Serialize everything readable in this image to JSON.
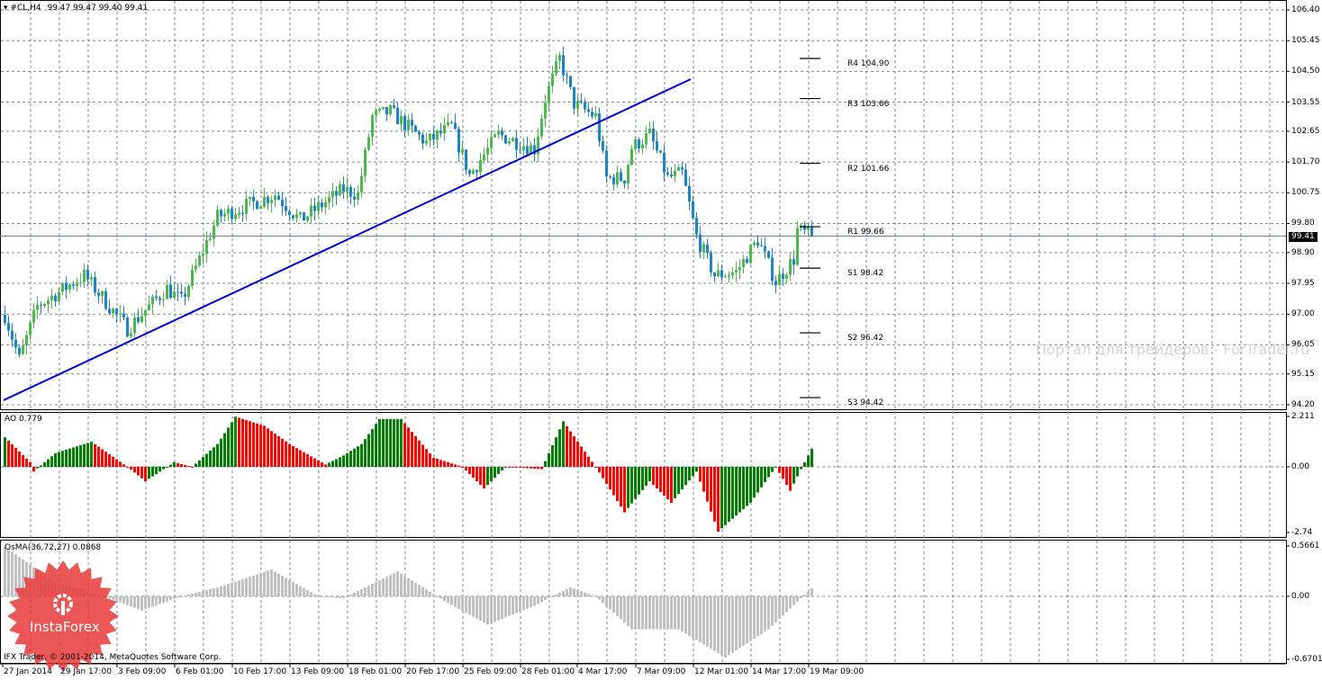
{
  "header": {
    "symbol": "#CL,H4",
    "ohlc": "99.47 99.47 99.40 99.41"
  },
  "watermark": "Портал для трейдеров - ForTrader.ru",
  "copyright": "IFX Trader, © 2001-2014, MetaQuotes Software Corp.",
  "logo_text": "InstaForex",
  "colors": {
    "bull": "#4cb94c",
    "bear": "#1a86c8",
    "ao_up": "#008000",
    "ao_down": "#ff0000",
    "osma": "#c0c0c0",
    "trendline": "#0000dd",
    "grid": "#7a8799"
  },
  "chart_data": {
    "type": "candlestick",
    "title": "#CL,H4",
    "current_price": "99.41",
    "price_axis_ticks": [
      "106.40",
      "105.45",
      "104.50",
      "103.55",
      "102.65",
      "101.70",
      "100.75",
      "99.80",
      "98.90",
      "97.95",
      "97.00",
      "96.05",
      "95.15",
      "94.20"
    ],
    "ylim": [
      94.2,
      106.4
    ],
    "time_axis_ticks": [
      "27 Jan 2014",
      "29 Jan 17:00",
      "3 Feb 09:00",
      "6 Feb 01:00",
      "10 Feb 17:00",
      "13 Feb 09:00",
      "18 Feb 01:00",
      "20 Feb 17:00",
      "25 Feb 09:00",
      "28 Feb 01:00",
      "4 Mar 17:00",
      "7 Mar 09:00",
      "12 Mar 01:00",
      "14 Mar 17:00",
      "19 Mar 09:00"
    ],
    "bars": 225,
    "close_path": [
      [
        0,
        96.98
      ],
      [
        4,
        95.6
      ],
      [
        9,
        97.25
      ],
      [
        22,
        98.2
      ],
      [
        34,
        96.55
      ],
      [
        45,
        97.8
      ],
      [
        49,
        97.4
      ],
      [
        59,
        100.0
      ],
      [
        75,
        100.7
      ],
      [
        82,
        99.9
      ],
      [
        94,
        100.85
      ],
      [
        98,
        100.7
      ],
      [
        102,
        103.1
      ],
      [
        107,
        103.25
      ],
      [
        117,
        102.3
      ],
      [
        124,
        102.8
      ],
      [
        129,
        101.3
      ],
      [
        137,
        102.55
      ],
      [
        147,
        102.1
      ],
      [
        150,
        103.65
      ],
      [
        154,
        104.9
      ],
      [
        158,
        103.5
      ],
      [
        164,
        103.1
      ],
      [
        167,
        101.2
      ],
      [
        172,
        101.2
      ],
      [
        174,
        102.15
      ],
      [
        179,
        102.55
      ],
      [
        184,
        101.2
      ],
      [
        188,
        101.35
      ],
      [
        192,
        99.4
      ],
      [
        197,
        98.2
      ],
      [
        203,
        98.3
      ],
      [
        209,
        99.3
      ],
      [
        214,
        98.0
      ],
      [
        219,
        98.7
      ],
      [
        220,
        99.6
      ],
      [
        224,
        99.41
      ]
    ],
    "trendline": {
      "from": [
        0,
        94.34
      ],
      "to": [
        190,
        104.26
      ]
    },
    "pivots": [
      {
        "label": "R4",
        "value": "104.90",
        "price": 104.9
      },
      {
        "label": "R3",
        "value": "103.66",
        "price": 103.66
      },
      {
        "label": "R2",
        "value": "101.66",
        "price": 101.66
      },
      {
        "label": "R1",
        "value": "99.66",
        "price": 99.7
      },
      {
        "label": "S1",
        "value": "98.42",
        "price": 98.42
      },
      {
        "label": "S2",
        "value": "96.42",
        "price": 96.42
      },
      {
        "label": "S3",
        "value": "94.42",
        "price": 94.42
      }
    ],
    "indicators": [
      {
        "name": "AO",
        "title": "AO 0.779",
        "ticks": [
          "2.211",
          "0.00",
          "-2.74"
        ],
        "ylim": [
          -2.74,
          2.211
        ],
        "path": [
          [
            0,
            1.3
          ],
          [
            7,
            0.2
          ],
          [
            8,
            -0.2
          ],
          [
            14,
            0.6
          ],
          [
            24,
            1.1
          ],
          [
            34,
            0.0
          ],
          [
            39,
            -0.6
          ],
          [
            47,
            0.2
          ],
          [
            52,
            0.0
          ],
          [
            59,
            1.0
          ],
          [
            64,
            2.2
          ],
          [
            72,
            1.8
          ],
          [
            79,
            1.0
          ],
          [
            89,
            0.1
          ],
          [
            94,
            0.5
          ],
          [
            99,
            1.0
          ],
          [
            104,
            2.1
          ],
          [
            110,
            2.1
          ],
          [
            119,
            0.4
          ],
          [
            127,
            0.0
          ],
          [
            133,
            -0.9
          ],
          [
            139,
            0.0
          ],
          [
            149,
            -0.1
          ],
          [
            155,
            2.0
          ],
          [
            164,
            0.0
          ],
          [
            172,
            -1.9
          ],
          [
            179,
            -0.6
          ],
          [
            185,
            -1.5
          ],
          [
            192,
            -0.2
          ],
          [
            198,
            -2.7
          ],
          [
            207,
            -1.5
          ],
          [
            214,
            0.0
          ],
          [
            218,
            -1.0
          ],
          [
            224,
            0.8
          ]
        ]
      },
      {
        "name": "OsMA",
        "title": "OsMA(36,72,27) 0.0868",
        "ticks": [
          "0.5661",
          "0.00",
          "-0.6701"
        ],
        "ylim": [
          -0.6701,
          0.5661
        ],
        "path": [
          [
            0,
            0.56
          ],
          [
            14,
            0.15
          ],
          [
            24,
            0.05
          ],
          [
            38,
            -0.15
          ],
          [
            49,
            0.0
          ],
          [
            59,
            0.1
          ],
          [
            74,
            0.3
          ],
          [
            87,
            0.0
          ],
          [
            94,
            -0.02
          ],
          [
            109,
            0.28
          ],
          [
            122,
            -0.05
          ],
          [
            134,
            -0.3
          ],
          [
            147,
            -0.1
          ],
          [
            157,
            0.1
          ],
          [
            164,
            0.0
          ],
          [
            174,
            -0.35
          ],
          [
            187,
            -0.35
          ],
          [
            200,
            -0.65
          ],
          [
            212,
            -0.35
          ],
          [
            224,
            0.09
          ]
        ]
      }
    ]
  }
}
